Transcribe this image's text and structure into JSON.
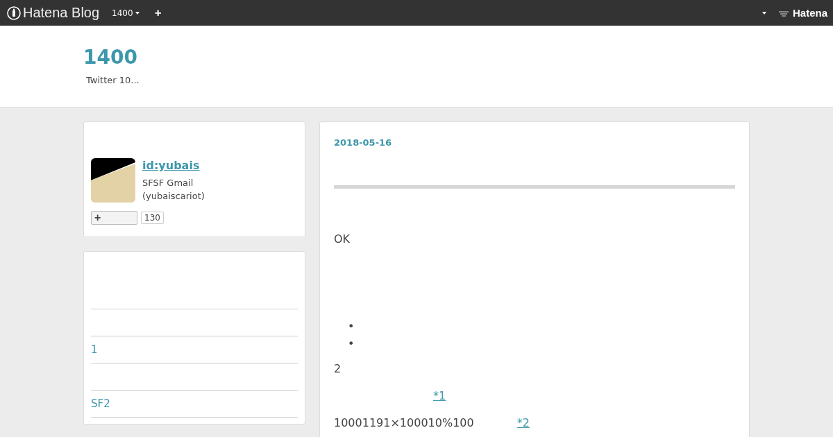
{
  "topbar": {
    "brand": "Hatena Blog",
    "blog_menu": "1400",
    "add": "+",
    "right_brand": "Hatena"
  },
  "header": {
    "title": "1400",
    "description": "Twitter 10..."
  },
  "profile": {
    "id": "id:yubais",
    "description": [
      "SFSF Gmail",
      "(yubaiscariot)"
    ],
    "subscribe": "+",
    "subscriber_count": "130"
  },
  "sidebar_links": [
    {
      "label": "1"
    },
    {
      "label": "SF2"
    }
  ],
  "entry": {
    "date": "2018-05-16",
    "paragraph_1": "OK",
    "bullets": [
      "•",
      "•"
    ],
    "paragraph_2": "2",
    "footnote_1": "*1",
    "paragraph_3": "10001191×100010%100",
    "footnote_2": "*2"
  }
}
